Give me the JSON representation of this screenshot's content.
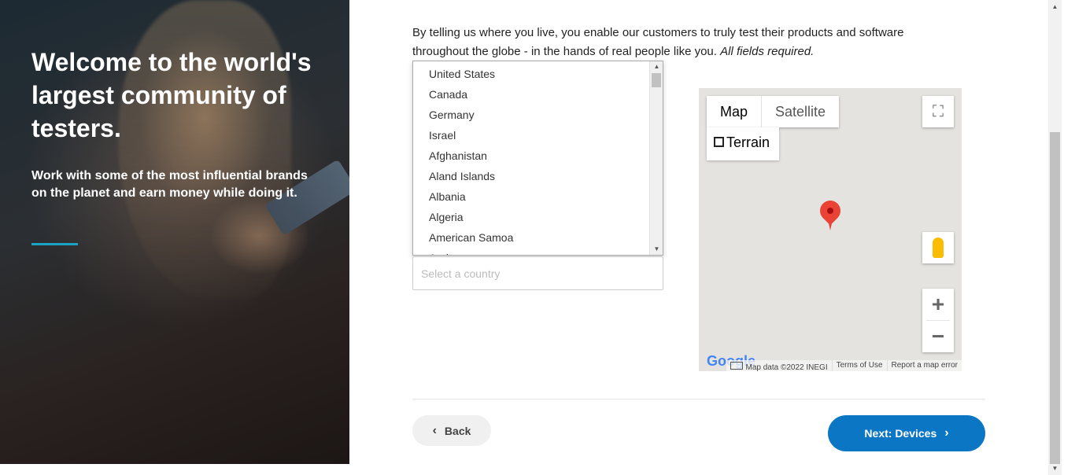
{
  "hero": {
    "title": "Welcome to the world's largest community of testers.",
    "subtitle": "Work with some of the most influential brands on the planet and earn money while doing it.",
    "accent_color": "#1aa3c4"
  },
  "intro": {
    "text": "By telling us where you live, you enable our customers to truly test their products and software throughout the globe - in the hands of real people like you.",
    "required_note": "All fields required."
  },
  "country_dropdown": {
    "options": [
      "United States",
      "Canada",
      "Germany",
      "Israel",
      "Afghanistan",
      "Aland Islands",
      "Albania",
      "Algeria",
      "American Samoa",
      "Andorra"
    ]
  },
  "country_input": {
    "placeholder": "Select a country",
    "value": ""
  },
  "map": {
    "map_label": "Map",
    "satellite_label": "Satellite",
    "terrain_label": "Terrain",
    "terrain_checked": false,
    "logo_text": "Google",
    "attribution": "Map data ©2022 INEGI",
    "terms": "Terms of Use",
    "report": "Report a map error",
    "zoom_in": "+",
    "zoom_out": "−",
    "fullscreen_glyph": "⛶"
  },
  "nav": {
    "back_label": "Back",
    "next_label": "Next: Devices",
    "next_color": "#0a76c4"
  }
}
